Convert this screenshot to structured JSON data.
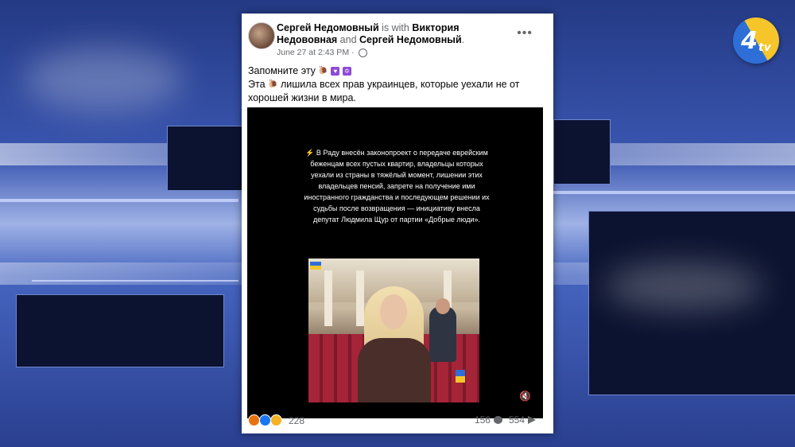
{
  "post": {
    "author": "Сергей Недомовный",
    "with_text": " is with ",
    "tagged_1": "Виктория Недововная",
    "and_text": " and ",
    "tagged_2": "Сергей Недомовный",
    "end_dot": ".",
    "date": "June 27 at 2:43 PM",
    "separator": "·",
    "more_label": "•••",
    "text_line1": "Запомните эту",
    "text_line2": "Эта",
    "text_line2_rest": " лишила всех прав украинцев, которые уехали не от хорошей жизни в мира.",
    "video_caption": "⚡ В Раду внесён законопроект о передаче еврейским беженцам всех пустых квартир, владельцы которых уехали из страны в тяжёлый момент, лишении этих владельцев пенсий, запрете на получение ими иностранного гражданства и последующем решении их судьбы после возвращения — инициативу внесла депутат Людмила Щур от партии «Добрые люди».",
    "reactions_count": "228",
    "comments_count": "156",
    "shares_count": "554"
  },
  "channel_logo": "4",
  "channel_logo_sub": "tv",
  "colors": {
    "accent": "#1877f2",
    "card": "#ffffff",
    "video_bg": "#000000"
  },
  "icons": [
    "globe-icon",
    "more-icon",
    "mute-icon",
    "comment-icon",
    "share-icon",
    "angry-reaction-icon",
    "like-reaction-icon",
    "wow-reaction-icon"
  ]
}
